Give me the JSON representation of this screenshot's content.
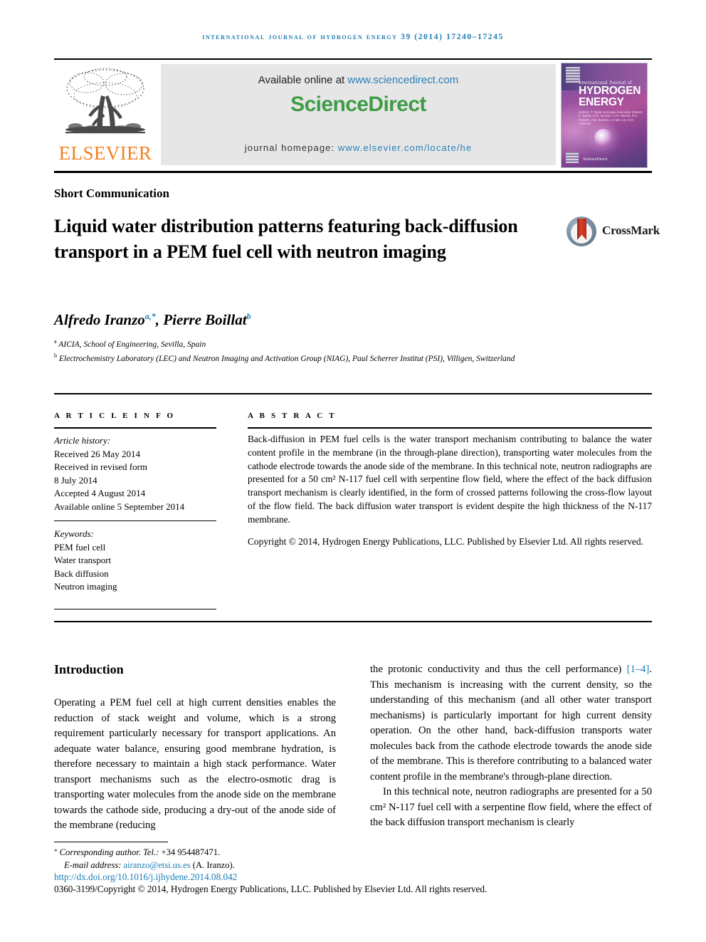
{
  "running_head": "International Journal of Hydrogen Energy 39 (2014) 17240–17245",
  "masthead": {
    "publisher_logo_text": "ELSEVIER",
    "available_prefix": "Available online at ",
    "available_link": "www.sciencedirect.com",
    "sciencedirect_logo": "ScienceDirect",
    "homepage_prefix": "journal homepage: ",
    "homepage_link": "www.elsevier.com/locate/he",
    "cover": {
      "superline": "International Journal of",
      "title_line1": "HYDROGEN",
      "title_line2": "ENERGY",
      "editors": "Editors:  T. Nejat Veziroglu\nAssociate Editors:  S. Barbir, D.D. Gordon, H.R. Warda, R.C. Roeder, J.M. Bockris, Le-Min Liu, D.D. Andrade",
      "sd_mark": "ScienceDirect"
    }
  },
  "article": {
    "section_type": "Short Communication",
    "title": "Liquid water distribution patterns featuring back-diffusion transport in a PEM fuel cell with neutron imaging",
    "crossmark_label": "CrossMark",
    "authors_plain": "Alfredo Iranzo",
    "author1": "Alfredo Iranzo",
    "author1_sup": "a,*",
    "author2": "Pierre Boillat",
    "author2_sup": "b",
    "affiliation_a_sup": "a",
    "affiliation_a": " AICIA, School of Engineering, Sevilla, Spain",
    "affiliation_b_sup": "b",
    "affiliation_b": " Electrochemistry Laboratory (LEC) and Neutron Imaging and Activation Group (NIAG), Paul Scherrer Institut (PSI), Villigen, Switzerland"
  },
  "article_info": {
    "heading": "A R T I C L E   I N F O",
    "history_label": "Article history:",
    "history": [
      "Received 26 May 2014",
      "Received in revised form",
      "8 July 2014",
      "Accepted 4 August 2014",
      "Available online 5 September 2014"
    ],
    "keywords_label": "Keywords:",
    "keywords": [
      "PEM fuel cell",
      "Water transport",
      "Back diffusion",
      "Neutron imaging"
    ]
  },
  "abstract": {
    "heading": "A B S T R A C T",
    "text": "Back-diffusion in PEM fuel cells is the water transport mechanism contributing to balance the water content profile in the membrane (in the through-plane direction), transporting water molecules from the cathode electrode towards the anode side of the membrane. In this technical note, neutron radiographs are presented for a 50 cm² N-117 fuel cell with serpentine flow field, where the effect of the back diffusion transport mechanism is clearly identified, in the form of crossed patterns following the cross-flow layout of the flow field. The back diffusion water transport is evident despite the high thickness of the N-117 membrane.",
    "copyright": "Copyright © 2014, Hydrogen Energy Publications, LLC. Published by Elsevier Ltd. All rights reserved."
  },
  "body": {
    "section_title": "Introduction",
    "left_paragraph": "Operating a PEM fuel cell at high current densities enables the reduction of stack weight and volume, which is a strong requirement particularly necessary for transport applications. An adequate water balance, ensuring good membrane hydration, is therefore necessary to maintain a high stack performance. Water transport mechanisms such as the electro-osmotic drag is transporting water molecules from the anode side on the membrane towards the cathode side, producing a dry-out of the anode side of the membrane (reducing",
    "right_paragraph_1_pre": "the protonic conductivity and thus the cell performance) ",
    "right_paragraph_1_ref": "[1–4]",
    "right_paragraph_1_post": ". This mechanism is increasing with the current density, so the understanding of this mechanism (and all other water transport mechanisms) is particularly important for high current density operation. On the other hand, back-diffusion transports water molecules back from the cathode electrode towards the anode side of the membrane. This is therefore contributing to a balanced water content profile in the membrane's through-plane direction.",
    "right_paragraph_2": "In this technical note, neutron radiographs are presented for a 50 cm² N-117 fuel cell with a serpentine flow field, where the effect of the back diffusion transport mechanism is clearly"
  },
  "footer": {
    "corresponding_star": "*",
    "corresponding_label": " Corresponding author. Tel.: ",
    "corresponding_tel": "+34 954487471.",
    "email_label": "E-mail address: ",
    "email": "airanzo@etsi.us.es",
    "email_suffix": " (A. Iranzo).",
    "doi": "http://dx.doi.org/10.1016/j.ijhydene.2014.08.042",
    "issn_line": "0360-3199/Copyright © 2014, Hydrogen Energy Publications, LLC. Published by Elsevier Ltd. All rights reserved."
  },
  "colors": {
    "link_blue": "#1b7bb5",
    "elsevier_orange": "#f08020",
    "sciencedirect_green": "#3f9c46",
    "banner_gray": "#e6e6e6"
  }
}
